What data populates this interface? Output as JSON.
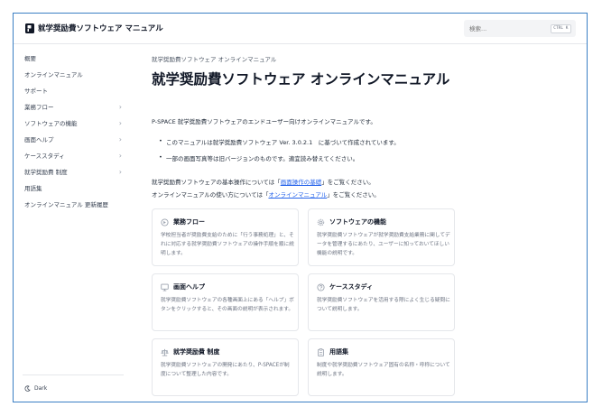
{
  "header": {
    "site_title": "就学奨励費ソフトウェア マニュアル",
    "search_placeholder": "検索...",
    "search_shortcut": "CTRL K"
  },
  "sidebar": {
    "items": [
      {
        "label": "概要",
        "has_children": false
      },
      {
        "label": "オンラインマニュアル",
        "has_children": false
      },
      {
        "label": "サポート",
        "has_children": false
      },
      {
        "label": "業務フロー",
        "has_children": true
      },
      {
        "label": "ソフトウェアの機能",
        "has_children": true
      },
      {
        "label": "画面ヘルプ",
        "has_children": true
      },
      {
        "label": "ケーススタディ",
        "has_children": true
      },
      {
        "label": "就学奨励費 制度",
        "has_children": true
      },
      {
        "label": "用語集",
        "has_children": false
      },
      {
        "label": "オンラインマニュアル 更新履歴",
        "has_children": false
      }
    ],
    "theme_toggle": "Dark"
  },
  "main": {
    "breadcrumb": "就学奨励費ソフトウェア オンラインマニュアル",
    "title": "就学奨励費ソフトウェア オンラインマニュアル",
    "intro": "P-SPACE 就学奨励費ソフトウェアのエンドユーザー向けオンラインマニュアルです。",
    "bullets": [
      "このマニュアルは就学奨励費ソフトウェア Ver. 3.0.2.1　に基づいて作成されています。",
      "一部の画面写真等は旧バージョンのものです。適宜読み替えてください。"
    ],
    "basic_ops": {
      "prefix": "就学奨励費ソフトウェアの基本操作については「",
      "link": "画面操作の基礎",
      "suffix": "」をご覧ください。"
    },
    "manual_usage": {
      "prefix": "オンラインマニュアルの使い方については「",
      "link": "オンラインマニュアル",
      "suffix": "」をご覧ください。"
    },
    "cards": [
      {
        "title": "業務フロー",
        "icon": "flow-icon",
        "desc": "学校担当者が奨励費支給のために「行う事務処理」と、それに対応する就学奨励費ソフトウェアの操作手順を順に説明します。"
      },
      {
        "title": "ソフトウェアの機能",
        "icon": "gear-icon",
        "desc": "就学奨励費ソフトウェアが就学奨励費支給業務に関してデータを管理するにあたり、ユーザーに知っておいてほしい機能の説明です。"
      },
      {
        "title": "画面ヘルプ",
        "icon": "monitor-icon",
        "desc": "就学奨励費ソフトウェアの各種画面上にある「ヘルプ」ボタンをクリックすると、その画面の説明が表示されます。"
      },
      {
        "title": "ケーススタディ",
        "icon": "question-icon",
        "desc": "就学奨励費ソフトウェアを活用する際によく生じる疑問について説明します。"
      },
      {
        "title": "就学奨励費 制度",
        "icon": "scale-icon",
        "desc": "就学奨励費ソフトウェアの開発にあたり、P-SPACEが制度について整理した内容です。"
      },
      {
        "title": "用語集",
        "icon": "clipboard-icon",
        "desc": "制度や就学奨励費ソフトウェア固有の名称・呼称について説明します。"
      }
    ]
  }
}
